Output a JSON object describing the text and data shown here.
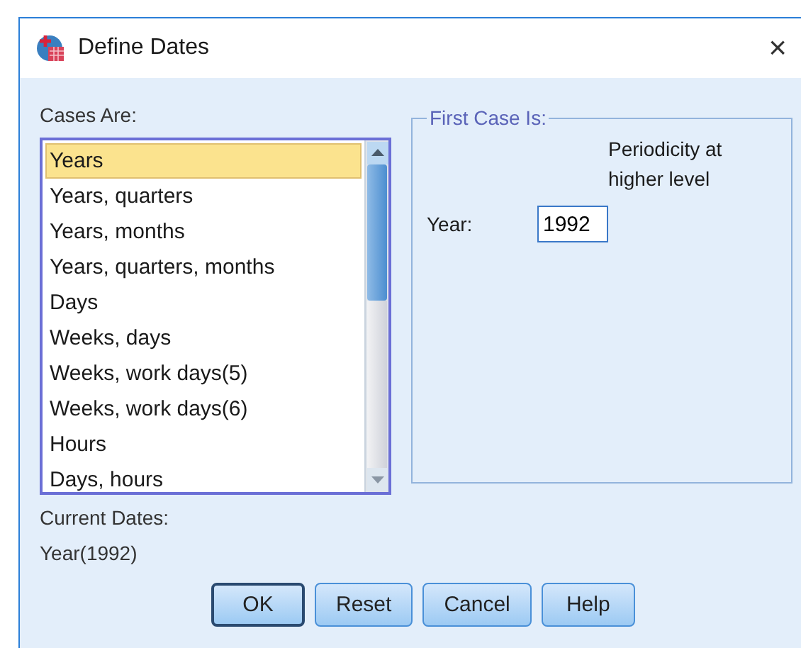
{
  "window": {
    "title": "Define Dates",
    "close": "×"
  },
  "cases_are": {
    "label": "Cases Are:",
    "items": [
      {
        "label": "Years",
        "selected": true
      },
      {
        "label": "Years, quarters",
        "selected": false
      },
      {
        "label": "Years, months",
        "selected": false
      },
      {
        "label": "Years, quarters, months",
        "selected": false
      },
      {
        "label": "Days",
        "selected": false
      },
      {
        "label": "Weeks, days",
        "selected": false
      },
      {
        "label": "Weeks, work days(5)",
        "selected": false
      },
      {
        "label": "Weeks, work days(6)",
        "selected": false
      },
      {
        "label": "Hours",
        "selected": false
      },
      {
        "label": "Days, hours",
        "selected": false
      }
    ]
  },
  "first_case": {
    "legend": "First Case Is:",
    "periodicity_header": "Periodicity at higher level",
    "fields": [
      {
        "label": "Year:",
        "value": "1992"
      }
    ]
  },
  "current_dates": {
    "label": "Current Dates:",
    "value": "Year(1992)"
  },
  "buttons": [
    {
      "label": "OK",
      "default": true
    },
    {
      "label": "Reset",
      "default": false
    },
    {
      "label": "Cancel",
      "default": false
    },
    {
      "label": "Help",
      "default": false
    }
  ]
}
